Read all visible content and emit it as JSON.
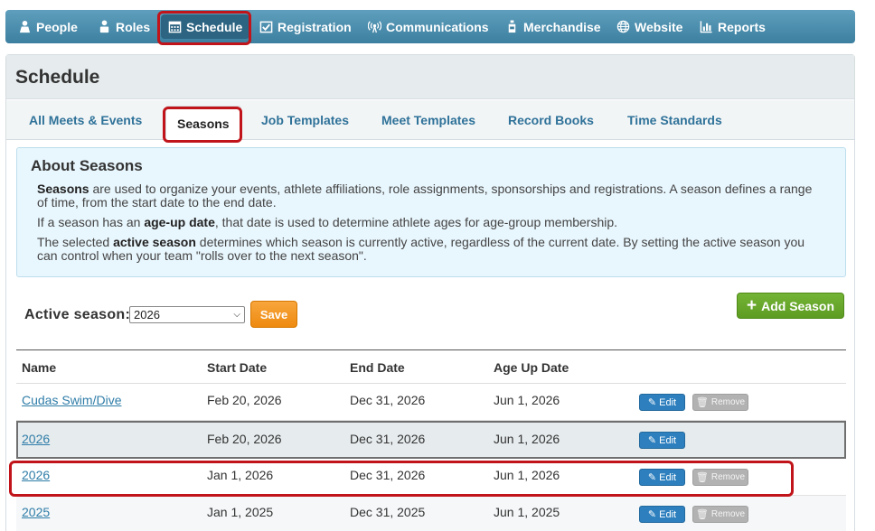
{
  "nav": {
    "items": [
      {
        "label": "People",
        "icon": "person-icon"
      },
      {
        "label": "Roles",
        "icon": "roles-icon"
      },
      {
        "label": "Schedule",
        "icon": "calendar-icon"
      },
      {
        "label": "Registration",
        "icon": "checkbox-icon"
      },
      {
        "label": "Communications",
        "icon": "broadcast-icon"
      },
      {
        "label": "Merchandise",
        "icon": "bottle-icon"
      },
      {
        "label": "Website",
        "icon": "globe-icon"
      },
      {
        "label": "Reports",
        "icon": "bar-chart-icon"
      }
    ],
    "active": "Schedule"
  },
  "page": {
    "title": "Schedule"
  },
  "tabs": [
    {
      "label": "All Meets & Events"
    },
    {
      "label": "Seasons"
    },
    {
      "label": "Job Templates"
    },
    {
      "label": "Meet Templates"
    },
    {
      "label": "Record Books"
    },
    {
      "label": "Time Standards"
    }
  ],
  "info": {
    "title": "About Seasons",
    "p1_bold": "Seasons",
    "p1_rest": " are used to organize your events, athlete affiliations, role assignments, sponsorships and registrations. A season defines a range of time, from the start date to the end date.",
    "p2_pre": "If a season has an ",
    "p2_bold": "age-up date",
    "p2_rest": ", that date is used to determine athlete ages for age-group membership.",
    "p3_pre": "The selected ",
    "p3_bold": "active season",
    "p3_rest": " determines which season is currently active, regardless of the current date. By setting the active season you can control when your team \"rolls over to the next season\"."
  },
  "active_season": {
    "label": "Active season:",
    "value": "2026",
    "save_label": "Save"
  },
  "add_season_label": "Add Season",
  "table": {
    "headers": [
      "Name",
      "Start Date",
      "End Date",
      "Age Up Date"
    ],
    "edit_label": "Edit",
    "remove_label": "Remove",
    "rows": [
      {
        "name": "Cudas Swim/Dive",
        "start": "Feb 20, 2026",
        "end": "Dec 31, 2026",
        "ageup": "Jun 1, 2026",
        "removable": true
      },
      {
        "name": "2026",
        "start": "Feb 20, 2026",
        "end": "Dec 31, 2026",
        "ageup": "Jun 1, 2026",
        "removable": false
      },
      {
        "name": "2026",
        "start": "Jan 1, 2026",
        "end": "Dec 31, 2026",
        "ageup": "Jun 1, 2026",
        "removable": true
      },
      {
        "name": "2025",
        "start": "Jan 1, 2025",
        "end": "Dec 31, 2025",
        "ageup": "Jun 1, 2025",
        "removable": true
      }
    ]
  },
  "colors": {
    "nav": "#3c7f9f",
    "highlight": "#c0141a",
    "edit": "#2d7fbe",
    "add": "#5d9c22",
    "save": "#ee8a0f"
  }
}
